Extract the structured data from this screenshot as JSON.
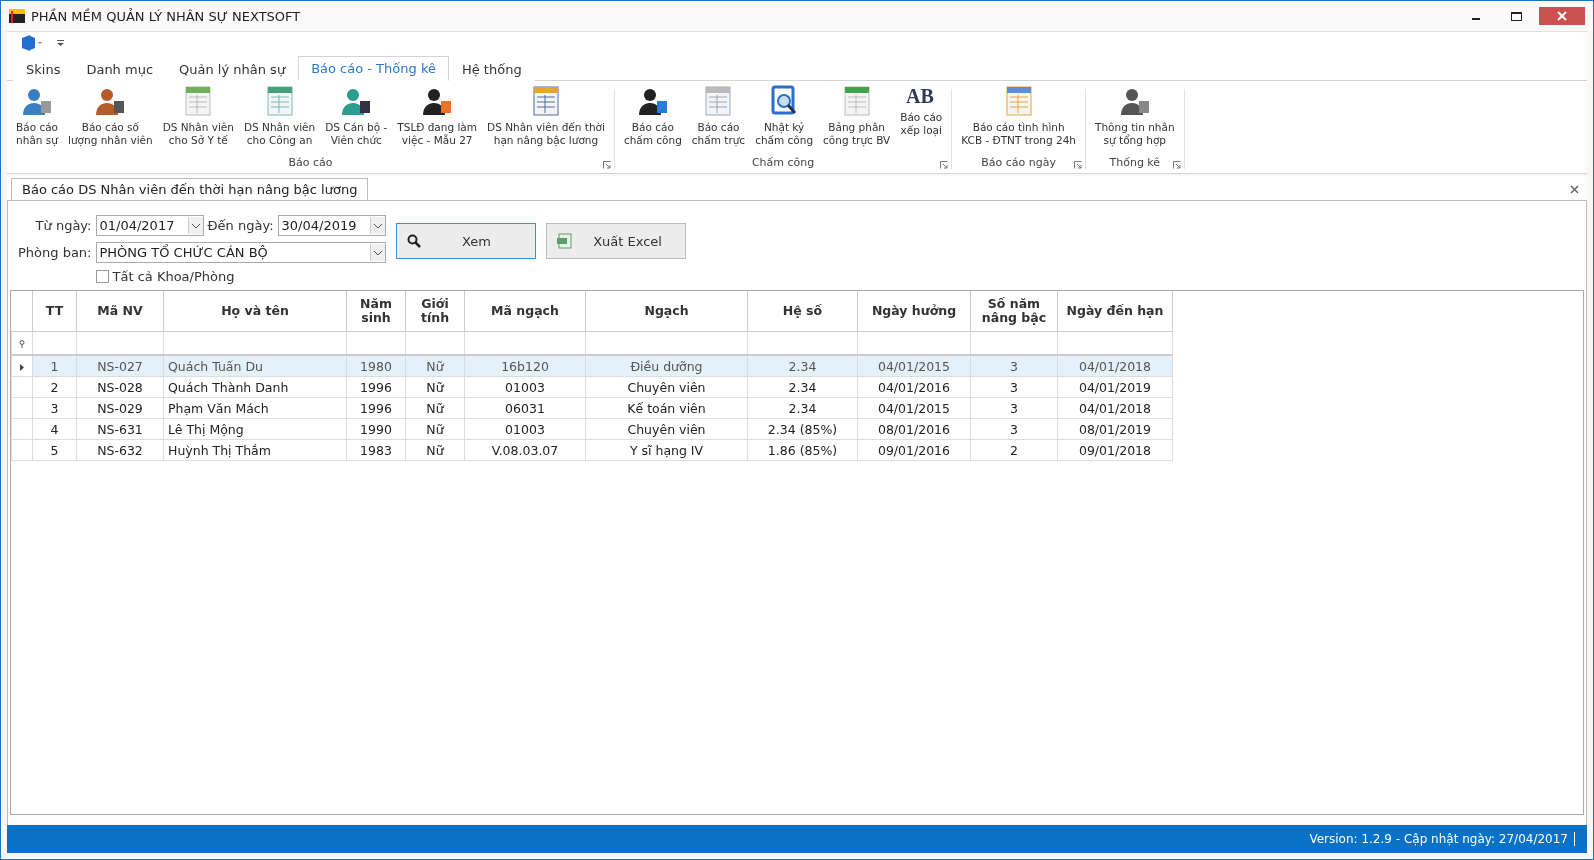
{
  "window": {
    "title": "PHẦN MỀM QUẢN LÝ NHÂN SỰ NEXTSOFT"
  },
  "tabs": [
    {
      "label": "Skins",
      "selected": false
    },
    {
      "label": "Danh mục",
      "selected": false
    },
    {
      "label": "Quản lý nhân sự",
      "selected": false
    },
    {
      "label": "Báo cáo - Thống kê",
      "selected": true
    },
    {
      "label": "Hệ thống",
      "selected": false
    }
  ],
  "ribbon_groups": [
    {
      "label": "Báo cáo",
      "items": [
        "Báo cáo\nnhân sự",
        "Báo cáo số\nlượng nhân viên",
        "DS Nhân viên\ncho Sở Y tế",
        "DS Nhân viên\ncho Công an",
        "DS Cán bộ -\nViên chức",
        "TSLĐ đang làm\nviệc - Mẫu 27",
        "DS Nhân viên đến thời\nhạn nâng bậc lương"
      ]
    },
    {
      "label": "Chấm công",
      "items": [
        "Báo cáo\nchấm công",
        "Báo cáo\nchấm trực",
        "Nhật ký\nchấm công",
        "Bảng phân\ncông trực BV",
        "Báo cáo\nxếp loại"
      ]
    },
    {
      "label": "Báo cáo ngày",
      "items": [
        "Báo cáo tình hình\nKCB - ĐTNT trong 24h"
      ]
    },
    {
      "label": "Thống kê",
      "items": [
        "Thông tin nhân\nsự tổng hợp"
      ]
    }
  ],
  "ab_glyph": "AB",
  "document_tab": {
    "label": "Báo cáo DS Nhân viên đến thời hạn nâng bậc lương"
  },
  "filters": {
    "from_label": "Từ ngày:",
    "from_value": "01/04/2017",
    "to_label": "Đến ngày:",
    "to_value": "30/04/2019",
    "department_label": "Phòng ban:",
    "department_value": "PHÒNG TỔ CHỨC CÁN BỘ",
    "all_departments": {
      "label": "Tất cả Khoa/Phòng",
      "checked": false
    }
  },
  "buttons": [
    {
      "label": "Xem",
      "kind": "search"
    },
    {
      "label": "Xuất Excel",
      "kind": "excel"
    }
  ],
  "table": {
    "columns": [
      "TT",
      "Mã NV",
      "Họ và tên",
      "Năm\nsinh",
      "Giới\ntính",
      "Mã ngạch",
      "Ngạch",
      "Hệ số",
      "Ngày hưởng",
      "Số năm\nnâng bậc",
      "Ngày đến hạn"
    ],
    "rows": [
      {
        "selected": true,
        "cells": [
          "1",
          "NS-027",
          "Quách Tuấn Du",
          "1980",
          "Nữ",
          "16b120",
          "Điều dưỡng",
          "2.34",
          "04/01/2015",
          "3",
          "04/01/2018"
        ]
      },
      {
        "selected": false,
        "cells": [
          "2",
          "NS-028",
          "Quách Thành Danh",
          "1996",
          "Nữ",
          "01003",
          "Chuyên viên",
          "2.34",
          "04/01/2016",
          "3",
          "04/01/2019"
        ]
      },
      {
        "selected": false,
        "cells": [
          "3",
          "NS-029",
          "Phạm Văn Mách",
          "1996",
          "Nữ",
          "06031",
          "Kế toán viên",
          "2.34",
          "04/01/2015",
          "3",
          "04/01/2018"
        ]
      },
      {
        "selected": false,
        "cells": [
          "4",
          "NS-631",
          "Lê Thị Mộng",
          "1990",
          "Nữ",
          "01003",
          "Chuyên viên",
          "2.34 (85%)",
          "08/01/2016",
          "3",
          "08/01/2019"
        ]
      },
      {
        "selected": false,
        "cells": [
          "5",
          "NS-632",
          "Huỳnh Thị Thắm",
          "1983",
          "Nữ",
          "V.08.03.07",
          "Y sĩ hạng IV",
          "1.86 (85%)",
          "09/01/2016",
          "2",
          "09/01/2018"
        ]
      }
    ]
  },
  "status_bar": {
    "text": "Version: 1.2.9 - Cập nhật ngày: 27/04/2017"
  }
}
